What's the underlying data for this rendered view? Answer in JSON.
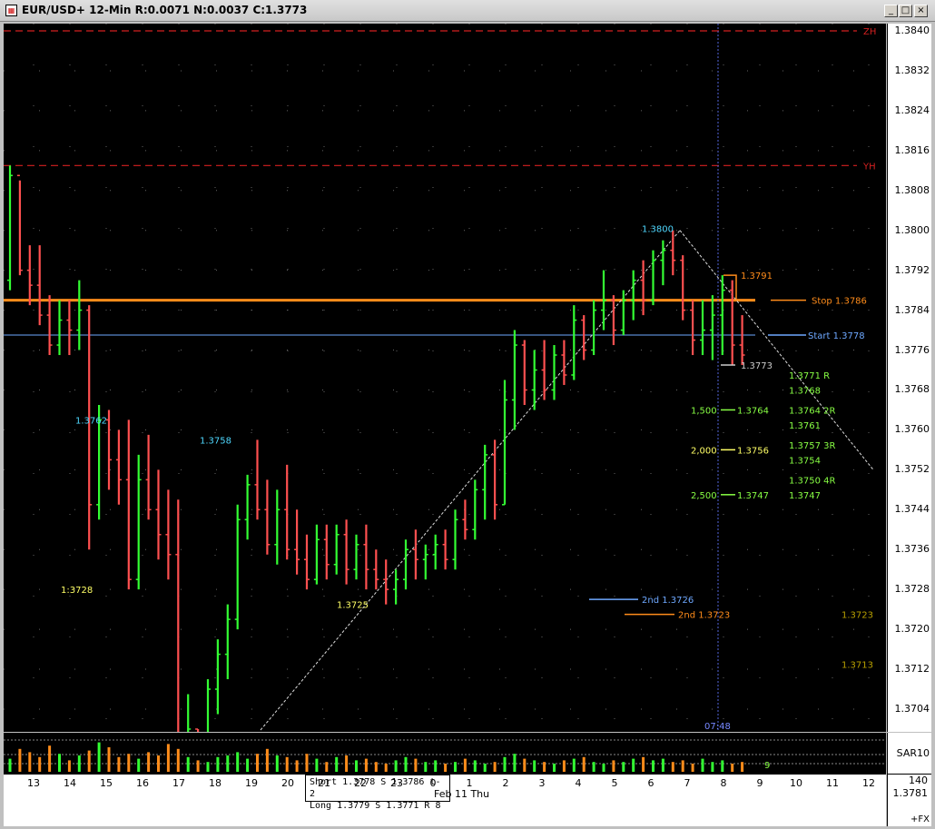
{
  "window": {
    "title": "EUR/USD+ 12-Min R:0.0071 N:0.0037 C:1.3773",
    "min_label": "_",
    "max_label": "□",
    "close_label": "×"
  },
  "colors": {
    "bg": "#000000",
    "up": "#33ff33",
    "down": "#ff5050",
    "stop": "#ff8c1a",
    "start": "#6ea8ff",
    "zone": "#d42020",
    "label_yellow": "#ffff66",
    "label_cyan": "#4fd8ff",
    "label_green": "#88ff44"
  },
  "y_axis": {
    "labels": [
      "1.3840",
      "1.3832",
      "1.3824",
      "1.3816",
      "1.3808",
      "1.3800",
      "1.3792",
      "1.3784",
      "1.3776",
      "1.3768",
      "1.3760",
      "1.3752",
      "1.3744",
      "1.3736",
      "1.3728",
      "1.3720",
      "1.3712",
      "1.3704"
    ],
    "indicator_label": "SAR10"
  },
  "x_axis": {
    "labels": [
      "13",
      "14",
      "15",
      "16",
      "17",
      "18",
      "19",
      "20",
      "21",
      "22",
      "23",
      "0",
      "1",
      "2",
      "3",
      "4",
      "5",
      "6",
      "7",
      "8",
      "9",
      "10",
      "11",
      "12"
    ],
    "date_label": "Feb 11 Thu",
    "corner_label": "+FX"
  },
  "readout": {
    "line1": "Short 1.3778  S 1.3786  t-2",
    "line2": "Long 1.3779  S 1.3771  R 8",
    "corner_top": "140",
    "corner_bottom": "1.3781"
  },
  "chart_data": {
    "type": "bar",
    "ylim": [
      1.3698,
      1.3842
    ],
    "levels": [
      {
        "name": "ZH",
        "price": 1.384,
        "style": "dashed"
      },
      {
        "name": "YH",
        "price": 1.3813,
        "style": "dashed"
      },
      {
        "name": "Stop",
        "label": "Stop 1.3786",
        "price": 1.3786
      },
      {
        "name": "Start",
        "label": "Start 1.3778",
        "price": 1.3779
      }
    ],
    "annotations": [
      {
        "text": "1.3762",
        "price": 1.3762
      },
      {
        "text": "1:3728",
        "price": 1.3728
      },
      {
        "text": "1.3758",
        "price": 1.3758
      },
      {
        "text": "1.3725",
        "price": 1.3725
      },
      {
        "text": "1.3800",
        "price": 1.38
      },
      {
        "text": "1.3791",
        "price": 1.3791
      },
      {
        "text": "1.3773",
        "price": 1.3773
      },
      {
        "text": "2nd 1.3726",
        "price": 1.3726
      },
      {
        "text": "2nd 1.3723",
        "price": 1.3723
      },
      {
        "text": "1.3723",
        "price": 1.3723
      },
      {
        "text": "1.3713",
        "price": 1.3713
      },
      {
        "text": "1,500",
        "price": 1.3764
      },
      {
        "text": "1.3764",
        "price": 1.3764
      },
      {
        "text": "2,000",
        "price": 1.3756
      },
      {
        "text": "1.3756",
        "price": 1.3756
      },
      {
        "text": "2,500",
        "price": 1.3747
      },
      {
        "text": "1.3747",
        "price": 1.3747
      },
      {
        "text": "1.3771 R",
        "price": 1.3771
      },
      {
        "text": "1.3768",
        "price": 1.3768
      },
      {
        "text": "1.3764 2R",
        "price": 1.3764
      },
      {
        "text": "1.3761",
        "price": 1.3761
      },
      {
        "text": "1.3757 3R",
        "price": 1.3757
      },
      {
        "text": "1.3754",
        "price": 1.3754
      },
      {
        "text": "1.3750 4R",
        "price": 1.375
      },
      {
        "text": "1.3747",
        "price": 1.3747
      },
      {
        "text": "07:48",
        "price": 1.37
      },
      {
        "text": "9",
        "price": 0
      }
    ],
    "bars": [
      [
        1.379,
        1.3813,
        1.3788,
        1.3811
      ],
      [
        1.3811,
        1.381,
        1.3791,
        1.3792
      ],
      [
        1.3792,
        1.3797,
        1.3785,
        1.3789
      ],
      [
        1.3789,
        1.3797,
        1.3781,
        1.3783
      ],
      [
        1.3783,
        1.3787,
        1.3775,
        1.3777
      ],
      [
        1.3777,
        1.3786,
        1.3775,
        1.3782
      ],
      [
        1.3782,
        1.3786,
        1.3775,
        1.378
      ],
      [
        1.378,
        1.379,
        1.3776,
        1.3784
      ],
      [
        1.3784,
        1.3785,
        1.3736,
        1.3745
      ],
      [
        1.3745,
        1.3765,
        1.3742,
        1.3762
      ],
      [
        1.3762,
        1.3764,
        1.3748,
        1.3754
      ],
      [
        1.3754,
        1.376,
        1.3745,
        1.375
      ],
      [
        1.375,
        1.3762,
        1.3728,
        1.373
      ],
      [
        1.373,
        1.3755,
        1.3728,
        1.375
      ],
      [
        1.375,
        1.3759,
        1.3742,
        1.3744
      ],
      [
        1.3744,
        1.3752,
        1.3734,
        1.3739
      ],
      [
        1.3739,
        1.3748,
        1.373,
        1.3735
      ],
      [
        1.3735,
        1.3746,
        1.3698,
        1.3698
      ],
      [
        1.3698,
        1.3707,
        1.3698,
        1.37
      ],
      [
        1.37,
        1.37,
        1.3698,
        1.3699
      ],
      [
        1.3699,
        1.371,
        1.3698,
        1.3708
      ],
      [
        1.3708,
        1.3718,
        1.3703,
        1.3715
      ],
      [
        1.3715,
        1.3725,
        1.371,
        1.3722
      ],
      [
        1.3722,
        1.3745,
        1.372,
        1.3742
      ],
      [
        1.3742,
        1.3751,
        1.3738,
        1.3749
      ],
      [
        1.3749,
        1.3758,
        1.3742,
        1.3744
      ],
      [
        1.3744,
        1.375,
        1.3735,
        1.3737
      ],
      [
        1.3737,
        1.3748,
        1.3733,
        1.3744
      ],
      [
        1.3744,
        1.3753,
        1.3734,
        1.3736
      ],
      [
        1.3736,
        1.3744,
        1.3731,
        1.3734
      ],
      [
        1.3734,
        1.3739,
        1.3728,
        1.373
      ],
      [
        1.373,
        1.3741,
        1.3729,
        1.3738
      ],
      [
        1.3738,
        1.3741,
        1.373,
        1.3733
      ],
      [
        1.3733,
        1.3741,
        1.3731,
        1.3739
      ],
      [
        1.3739,
        1.3742,
        1.3729,
        1.3732
      ],
      [
        1.3732,
        1.3739,
        1.373,
        1.3737
      ],
      [
        1.3737,
        1.3741,
        1.3728,
        1.3732
      ],
      [
        1.3732,
        1.3736,
        1.3728,
        1.373
      ],
      [
        1.373,
        1.3734,
        1.3725,
        1.3728
      ],
      [
        1.3728,
        1.3732,
        1.3725,
        1.373
      ],
      [
        1.373,
        1.3738,
        1.3728,
        1.3736
      ],
      [
        1.3736,
        1.374,
        1.373,
        1.3734
      ],
      [
        1.3734,
        1.3737,
        1.373,
        1.3735
      ],
      [
        1.3735,
        1.3739,
        1.3732,
        1.3737
      ],
      [
        1.3737,
        1.374,
        1.3732,
        1.3734
      ],
      [
        1.3734,
        1.3744,
        1.3732,
        1.3742
      ],
      [
        1.3742,
        1.3746,
        1.3738,
        1.374
      ],
      [
        1.374,
        1.375,
        1.3738,
        1.3748
      ],
      [
        1.3748,
        1.3757,
        1.3742,
        1.3755
      ],
      [
        1.3755,
        1.3758,
        1.3742,
        1.3745
      ],
      [
        1.3745,
        1.377,
        1.3745,
        1.3766
      ],
      [
        1.3766,
        1.378,
        1.376,
        1.3777
      ],
      [
        1.3777,
        1.3778,
        1.3765,
        1.3768
      ],
      [
        1.3768,
        1.3776,
        1.3764,
        1.3772
      ],
      [
        1.3772,
        1.3778,
        1.3766,
        1.3768
      ],
      [
        1.3768,
        1.3777,
        1.3766,
        1.3775
      ],
      [
        1.3775,
        1.3778,
        1.3769,
        1.3771
      ],
      [
        1.3771,
        1.3785,
        1.377,
        1.3782
      ],
      [
        1.3782,
        1.3783,
        1.3774,
        1.3776
      ],
      [
        1.3776,
        1.3786,
        1.3775,
        1.3784
      ],
      [
        1.3784,
        1.3792,
        1.378,
        1.3786
      ],
      [
        1.3786,
        1.3787,
        1.3777,
        1.378
      ],
      [
        1.378,
        1.3788,
        1.3779,
        1.3786
      ],
      [
        1.3786,
        1.3792,
        1.3782,
        1.379
      ],
      [
        1.379,
        1.3794,
        1.3783,
        1.3786
      ],
      [
        1.3786,
        1.3796,
        1.3785,
        1.3794
      ],
      [
        1.3794,
        1.3798,
        1.3789,
        1.3796
      ],
      [
        1.3796,
        1.38,
        1.3791,
        1.3794
      ],
      [
        1.3794,
        1.3795,
        1.3782,
        1.3784
      ],
      [
        1.3784,
        1.3786,
        1.3775,
        1.3778
      ],
      [
        1.3778,
        1.3786,
        1.3775,
        1.378
      ],
      [
        1.378,
        1.3787,
        1.3774,
        1.3783
      ],
      [
        1.3783,
        1.3791,
        1.3775,
        1.3788
      ],
      [
        1.3788,
        1.379,
        1.3773,
        1.3777
      ],
      [
        1.3777,
        1.3783,
        1.3773,
        1.3775
      ]
    ],
    "volume": [
      8,
      14,
      12,
      9,
      16,
      11,
      7,
      10,
      13,
      18,
      15,
      9,
      11,
      8,
      12,
      10,
      17,
      14,
      9,
      7,
      6,
      9,
      10,
      12,
      8,
      11,
      14,
      10,
      9,
      7,
      11,
      8,
      6,
      9,
      10,
      7,
      8,
      6,
      5,
      7,
      9,
      8,
      6,
      7,
      5,
      6,
      8,
      7,
      5,
      6,
      9,
      11,
      8,
      7,
      6,
      5,
      7,
      8,
      9,
      6,
      5,
      7,
      6,
      8,
      9,
      7,
      8,
      6,
      7,
      5,
      8,
      6,
      7,
      5,
      6
    ]
  }
}
